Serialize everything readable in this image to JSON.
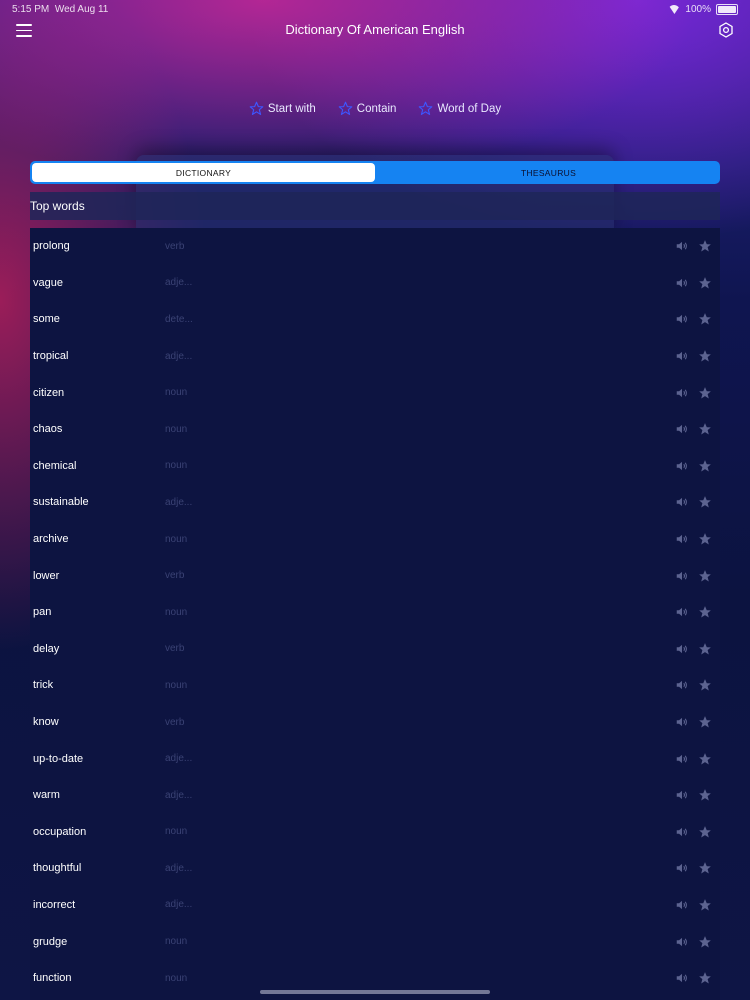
{
  "status_bar": {
    "time": "5:15 PM",
    "date": "Wed Aug 11",
    "battery": "100%"
  },
  "header": {
    "title": "Dictionary Of American English"
  },
  "filters": [
    {
      "label": "Start with"
    },
    {
      "label": "Contain"
    },
    {
      "label": "Word of Day"
    }
  ],
  "tabs": [
    {
      "label": "DICTIONARY",
      "active": true
    },
    {
      "label": "THESAURUS",
      "active": false
    }
  ],
  "section": {
    "title": "Top words"
  },
  "words": [
    {
      "word": "prolong",
      "pos": "verb"
    },
    {
      "word": "vague",
      "pos": "adje..."
    },
    {
      "word": "some",
      "pos": "dete..."
    },
    {
      "word": "tropical",
      "pos": "adje..."
    },
    {
      "word": "citizen",
      "pos": "noun"
    },
    {
      "word": "chaos",
      "pos": "noun"
    },
    {
      "word": "chemical",
      "pos": "noun"
    },
    {
      "word": "sustainable",
      "pos": "adje..."
    },
    {
      "word": "archive",
      "pos": "noun"
    },
    {
      "word": "lower",
      "pos": "verb"
    },
    {
      "word": "pan",
      "pos": "noun"
    },
    {
      "word": "delay",
      "pos": "verb"
    },
    {
      "word": "trick",
      "pos": "noun"
    },
    {
      "word": "know",
      "pos": "verb"
    },
    {
      "word": "up-to-date",
      "pos": "adje..."
    },
    {
      "word": "warm",
      "pos": "adje..."
    },
    {
      "word": "occupation",
      "pos": "noun"
    },
    {
      "word": "thoughtful",
      "pos": "adje..."
    },
    {
      "word": "incorrect",
      "pos": "adje..."
    },
    {
      "word": "grudge",
      "pos": "noun"
    },
    {
      "word": "function",
      "pos": "noun"
    }
  ],
  "colors": {
    "accent": "#1583f2",
    "filter_star": "#3d56ff",
    "list_bg": "#0d1441",
    "row_icon": "#5c6390"
  },
  "icons": {
    "menu": "hamburger-icon",
    "settings": "gear-icon",
    "filter": "star-outline-icon",
    "speaker": "speaker-icon",
    "favorite": "star-icon"
  }
}
